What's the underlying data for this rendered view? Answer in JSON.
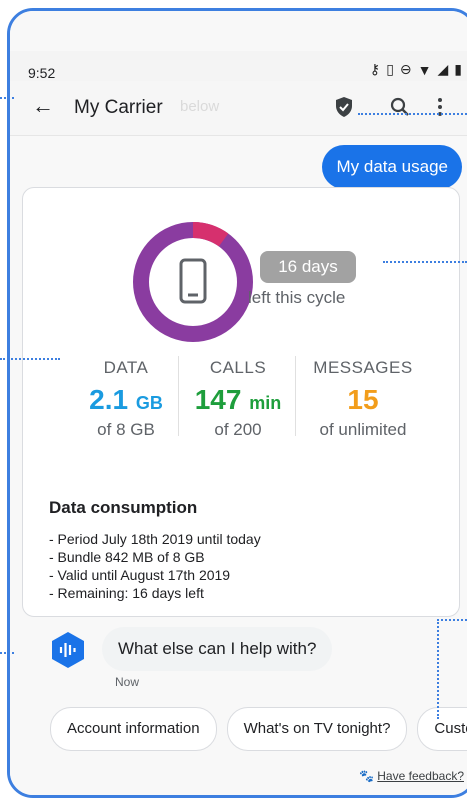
{
  "status_bar": {
    "time": "9:52",
    "icons": [
      "key-icon",
      "vibrate-icon",
      "dnd-icon",
      "wifi-icon",
      "signal-icon",
      "battery-icon"
    ]
  },
  "app_bar": {
    "title": "My Carrier",
    "ghost_text": "below",
    "icons": [
      "back-arrow-icon",
      "shield-icon",
      "search-icon",
      "more-vert-icon"
    ]
  },
  "user_message": "My data usage",
  "usage_card": {
    "days_left": "16 days",
    "days_caption": "left this cycle",
    "stats": [
      {
        "label": "DATA",
        "value": "2.1",
        "unit": "GB",
        "sub": "of 8 GB",
        "color": "#1a9be0"
      },
      {
        "label": "CALLS",
        "value": "147",
        "unit": "min",
        "sub": "of 200",
        "color": "#1e9e3c"
      },
      {
        "label": "MESSAGES",
        "value": "15",
        "unit": "",
        "sub": "of unlimited",
        "color": "#f29d1b"
      }
    ],
    "cycle_fraction_used": 0.1,
    "ring_colors": {
      "main": "#8a3ca0",
      "accent": "#d6306e"
    },
    "consumption": {
      "title": "Data consumption",
      "lines": [
        "- Period July 18th 2019 until today",
        "- Bundle 842 MB of 8 GB",
        "- Valid until August 17th 2019",
        "- Remaining: 16 days left"
      ]
    }
  },
  "assistant": {
    "message": "What else can I help with?",
    "time": "Now"
  },
  "chips": [
    "Account information",
    "What's on TV tonight?",
    "Custom"
  ],
  "feedback": {
    "link": "Have feedback?"
  },
  "colors": {
    "accent": "#1a73e8",
    "frame": "#3d7fe0"
  }
}
